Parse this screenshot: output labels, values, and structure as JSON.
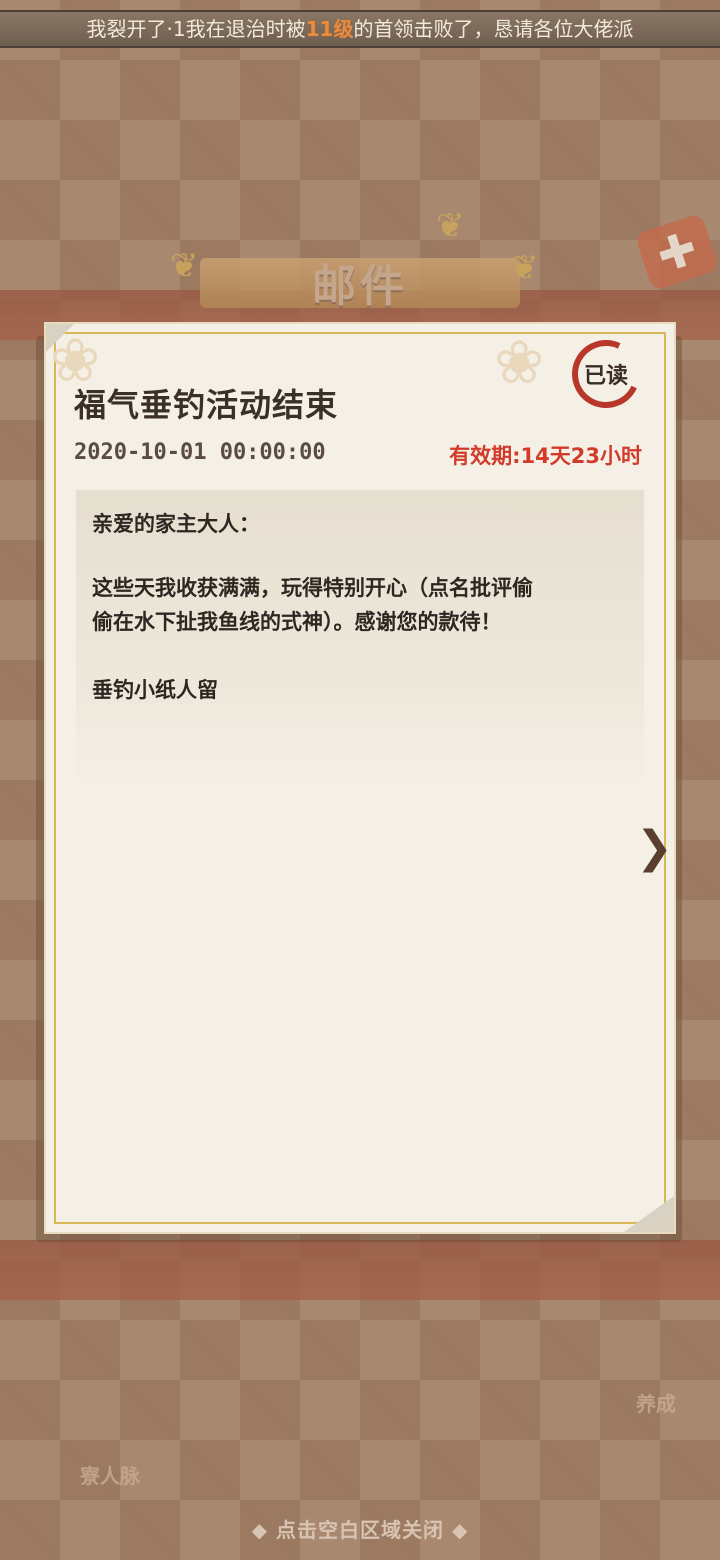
{
  "notice": {
    "prefix": "我裂开了·1我在退治时被",
    "highlight": "11级",
    "suffix": "的首领击败了，恳请各位大佬派"
  },
  "header": {
    "title": "邮件"
  },
  "mail": {
    "title": "福气垂钓活动结束",
    "date": "2020-10-01 00:00:00",
    "expire": "有效期:14天23小时",
    "status": "已读",
    "greeting": "亲爱的家主大人：",
    "body_line1": "这些天我收获满满，玩得特别开心（点名批评偷",
    "body_line2": "偷在水下扯我鱼线的式神）。感谢您的款待！",
    "signature": "垂钓小纸人留"
  },
  "background": {
    "bottom_label_left": "寮人脉",
    "bottom_label_right": "养成"
  },
  "footer": {
    "hint": "◆ 点击空白区域关闭 ◆"
  },
  "colors": {
    "accent_red": "#d23b2b",
    "stamp_red": "#b8372a",
    "paper": "#f4f0e6",
    "gold_border": "#d9b85a"
  },
  "icons": {
    "close": "close-icon",
    "next": "chevron-right-icon",
    "read_stamp": "read-stamp-icon"
  }
}
